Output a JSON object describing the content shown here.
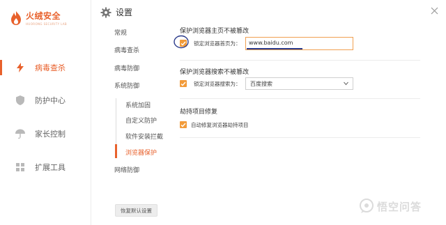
{
  "app": {
    "name": "火绒安全",
    "subtitle": "HUORONG SECURITY LAB",
    "accent_color": "#e8612c"
  },
  "sidebar": {
    "items": [
      {
        "label": "病毒查杀",
        "icon": "lightning-icon",
        "active": true
      },
      {
        "label": "防护中心",
        "icon": "shield-icon",
        "active": false
      },
      {
        "label": "家长控制",
        "icon": "umbrella-icon",
        "active": false
      },
      {
        "label": "扩展工具",
        "icon": "grid-icon",
        "active": false
      }
    ]
  },
  "settings": {
    "title": "设置",
    "menu": [
      {
        "label": "常规"
      },
      {
        "label": "病毒查杀"
      },
      {
        "label": "病毒防御"
      },
      {
        "label": "系统防御"
      }
    ],
    "submenu": [
      {
        "label": "系统加固",
        "active": false
      },
      {
        "label": "自定义防护",
        "active": false
      },
      {
        "label": "软件安装拦截",
        "active": false
      },
      {
        "label": "浏览器保护",
        "active": true
      }
    ],
    "network": {
      "label": "网络防御"
    },
    "restore_button": "恢复默认设置"
  },
  "content": {
    "sections": [
      {
        "title": "保护浏览器主页不被篡改",
        "checkbox_label": "锁定浏览器首页为：",
        "checked": true,
        "input_value": "www.baidu.com"
      },
      {
        "title": "保护浏览器搜索不被篡改",
        "checkbox_label": "锁定浏览器搜索为：",
        "checked": true,
        "select_value": "百度搜索"
      },
      {
        "title": "劫持项目修复",
        "checkbox_label": "自动修复浏览器劫持项目",
        "checked": true
      }
    ]
  },
  "watermark": {
    "text": "悟空问答"
  }
}
